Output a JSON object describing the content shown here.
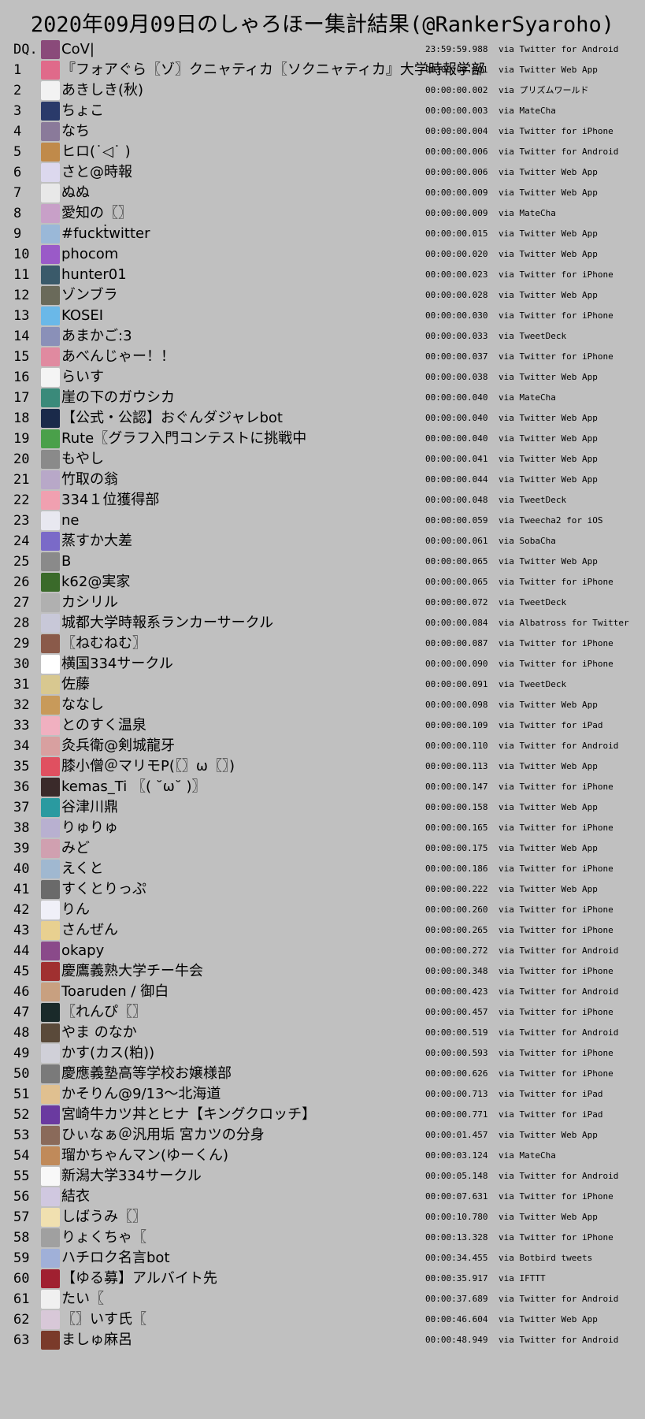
{
  "title": "2020年09月09日のしゃろほー集計結果(@RankerSyaroho)",
  "rows": [
    {
      "rank": "DQ.",
      "name": "CoV|",
      "time": "23:59:59.988",
      "via": "via Twitter for Android",
      "color": "#8a4a7a"
    },
    {
      "rank": "1",
      "name": "『フォアぐら〖ゾ〗クニャティカ〖ソクニャティカ』大学時報学部",
      "time": "00:00:00.001",
      "via": "via Twitter Web App",
      "color": "#e06a8a"
    },
    {
      "rank": "2",
      "name": "あきしき(秋)",
      "time": "00:00:00.002",
      "via": "via プリズムワールド",
      "color": "#f2f2f2"
    },
    {
      "rank": "3",
      "name": "ちょこ",
      "time": "00:00:00.003",
      "via": "via MateCha",
      "color": "#2a3a6a"
    },
    {
      "rank": "4",
      "name": "なち",
      "time": "00:00:00.004",
      "via": "via Twitter for iPhone",
      "color": "#8a7a9a"
    },
    {
      "rank": "5",
      "name": "ヒロ(˙◁˙ )",
      "time": "00:00:00.006",
      "via": "via Twitter for Android",
      "color": "#c08a4a"
    },
    {
      "rank": "6",
      "name": "さと@時報",
      "time": "00:00:00.006",
      "via": "via Twitter Web App",
      "color": "#dcd8ee"
    },
    {
      "rank": "7",
      "name": "ぬぬ",
      "time": "00:00:00.009",
      "via": "via Twitter Web App",
      "color": "#e8e8e8"
    },
    {
      "rank": "8",
      "name": "愛知の〖〗",
      "time": "00:00:00.009",
      "via": "via MateCha",
      "color": "#c8a0c8"
    },
    {
      "rank": "9",
      "name": "#fuckṫwitter",
      "time": "00:00:00.015",
      "via": "via Twitter Web App",
      "color": "#9ab8d8"
    },
    {
      "rank": "10",
      "name": "phocom",
      "time": "00:00:00.020",
      "via": "via Twitter Web App",
      "color": "#9a5ac8"
    },
    {
      "rank": "11",
      "name": "hunter01",
      "time": "00:00:00.023",
      "via": "via Twitter for iPhone",
      "color": "#3a5a6a"
    },
    {
      "rank": "12",
      "name": "ゾンブラ",
      "time": "00:00:00.028",
      "via": "via Twitter Web App",
      "color": "#6a6a5a"
    },
    {
      "rank": "13",
      "name": "KOSEI",
      "time": "00:00:00.030",
      "via": "via Twitter for iPhone",
      "color": "#6ab8e8"
    },
    {
      "rank": "14",
      "name": "あまかご:3",
      "time": "00:00:00.033",
      "via": "via TweetDeck",
      "color": "#8a90b8"
    },
    {
      "rank": "15",
      "name": "あべんじゃー！！",
      "time": "00:00:00.037",
      "via": "via Twitter for iPhone",
      "color": "#e08aa0"
    },
    {
      "rank": "16",
      "name": "らいす",
      "time": "00:00:00.038",
      "via": "via Twitter Web App",
      "color": "#f4f4f4"
    },
    {
      "rank": "17",
      "name": "崖の下のガウシカ",
      "time": "00:00:00.040",
      "via": "via MateCha",
      "color": "#3a8a7a"
    },
    {
      "rank": "18",
      "name": "【公式・公認】おぐんダジャレbot",
      "time": "00:00:00.040",
      "via": "via Twitter Web App",
      "color": "#1a2a4a"
    },
    {
      "rank": "19",
      "name": "Rute〖グラフ入門コンテストに挑戦中",
      "time": "00:00:00.040",
      "via": "via Twitter Web App",
      "color": "#4aa04a"
    },
    {
      "rank": "20",
      "name": "もやし",
      "time": "00:00:00.041",
      "via": "via Twitter Web App",
      "color": "#8a8a8a"
    },
    {
      "rank": "21",
      "name": "竹取の翁",
      "time": "00:00:00.044",
      "via": "via Twitter Web App",
      "color": "#b8a8c8"
    },
    {
      "rank": "22",
      "name": "334１位獲得部",
      "time": "00:00:00.048",
      "via": "via TweetDeck",
      "color": "#f0a0b0"
    },
    {
      "rank": "23",
      "name": "ne",
      "time": "00:00:00.059",
      "via": "via Tweecha2 for iOS",
      "color": "#e8e8f0"
    },
    {
      "rank": "24",
      "name": "蒸すか大差",
      "time": "00:00:00.061",
      "via": "via SobaCha",
      "color": "#7a6ac8"
    },
    {
      "rank": "25",
      "name": "B",
      "time": "00:00:00.065",
      "via": "via Twitter Web App",
      "color": "#8a8a8a"
    },
    {
      "rank": "26",
      "name": "k62@実家",
      "time": "00:00:00.065",
      "via": "via Twitter for iPhone",
      "color": "#3a6a2a"
    },
    {
      "rank": "27",
      "name": "カシリル",
      "time": "00:00:00.072",
      "via": "via TweetDeck",
      "color": "#b0b0b0"
    },
    {
      "rank": "28",
      "name": "城都大学時報系ランカーサークル",
      "time": "00:00:00.084",
      "via": "via Albatross for Twitter",
      "color": "#c8c8d8"
    },
    {
      "rank": "29",
      "name": "〖ねむねむ〗",
      "time": "00:00:00.087",
      "via": "via Twitter for iPhone",
      "color": "#8a5a4a"
    },
    {
      "rank": "30",
      "name": "横国334サークル",
      "time": "00:00:00.090",
      "via": "via Twitter for iPhone",
      "color": "#ffffff"
    },
    {
      "rank": "31",
      "name": "佐藤",
      "time": "00:00:00.091",
      "via": "via TweetDeck",
      "color": "#d8c890"
    },
    {
      "rank": "32",
      "name": "ななし",
      "time": "00:00:00.098",
      "via": "via Twitter Web App",
      "color": "#c89a5a"
    },
    {
      "rank": "33",
      "name": "とのすく温泉",
      "time": "00:00:00.109",
      "via": "via Twitter for iPad",
      "color": "#f0b0c0"
    },
    {
      "rank": "34",
      "name": "灸兵衛@剣城龍牙",
      "time": "00:00:00.110",
      "via": "via Twitter for Android",
      "color": "#d8a0a0"
    },
    {
      "rank": "35",
      "name": "膝小僧＠マリモP(〖〗ω〖〗)",
      "time": "00:00:00.113",
      "via": "via Twitter Web App",
      "color": "#e05060"
    },
    {
      "rank": "36",
      "name": "kemas_Ti 〖( ˘ω˘ )〗",
      "time": "00:00:00.147",
      "via": "via Twitter for iPhone",
      "color": "#3a2a2a"
    },
    {
      "rank": "37",
      "name": "谷津川鼎",
      "time": "00:00:00.158",
      "via": "via Twitter Web App",
      "color": "#2a9aa0"
    },
    {
      "rank": "38",
      "name": "りゅりゅ",
      "time": "00:00:00.165",
      "via": "via Twitter for iPhone",
      "color": "#b8b0d0"
    },
    {
      "rank": "39",
      "name": "みど",
      "time": "00:00:00.175",
      "via": "via Twitter Web App",
      "color": "#d0a0b0"
    },
    {
      "rank": "40",
      "name": "えくと",
      "time": "00:00:00.186",
      "via": "via Twitter for iPhone",
      "color": "#a0b8d0"
    },
    {
      "rank": "41",
      "name": "すくとりっぷ",
      "time": "00:00:00.222",
      "via": "via Twitter Web App",
      "color": "#6a6a6a"
    },
    {
      "rank": "42",
      "name": "りん",
      "time": "00:00:00.260",
      "via": "via Twitter for iPhone",
      "color": "#f0f0f8"
    },
    {
      "rank": "43",
      "name": "さんぜん",
      "time": "00:00:00.265",
      "via": "via Twitter for iPhone",
      "color": "#e8d090"
    },
    {
      "rank": "44",
      "name": "okapy",
      "time": "00:00:00.272",
      "via": "via Twitter for Android",
      "color": "#8a4a8a"
    },
    {
      "rank": "45",
      "name": "慶鷹義熟大学チー牛会",
      "time": "00:00:00.348",
      "via": "via Twitter for iPhone",
      "color": "#a03030"
    },
    {
      "rank": "46",
      "name": "Toaruden / 御白",
      "time": "00:00:00.423",
      "via": "via Twitter for Android",
      "color": "#c8a080"
    },
    {
      "rank": "47",
      "name": "〖れんぴ〖〗",
      "time": "00:00:00.457",
      "via": "via Twitter for iPhone",
      "color": "#1a2a2a"
    },
    {
      "rank": "48",
      "name": "やま のなか",
      "time": "00:00:00.519",
      "via": "via Twitter for Android",
      "color": "#5a4a3a"
    },
    {
      "rank": "49",
      "name": "かす(カス(粕))",
      "time": "00:00:00.593",
      "via": "via Twitter for iPhone",
      "color": "#d0d0d8"
    },
    {
      "rank": "50",
      "name": "慶應義塾高等学校お嬢様部",
      "time": "00:00:00.626",
      "via": "via Twitter for iPhone",
      "color": "#7a7a7a"
    },
    {
      "rank": "51",
      "name": "かそりん@9/13〜北海道",
      "time": "00:00:00.713",
      "via": "via Twitter for iPad",
      "color": "#e0c090"
    },
    {
      "rank": "52",
      "name": "宮崎牛カツ丼とヒナ【キングクロッチ】",
      "time": "00:00:00.771",
      "via": "via Twitter for iPad",
      "color": "#6a3aa0"
    },
    {
      "rank": "53",
      "name": "ひぃなぁ＠汎用垢 宮カツの分身",
      "time": "00:00:01.457",
      "via": "via Twitter Web App",
      "color": "#8a6a5a"
    },
    {
      "rank": "54",
      "name": "瑠かちゃんマン(ゆーくん)",
      "time": "00:00:03.124",
      "via": "via MateCha",
      "color": "#c08a5a"
    },
    {
      "rank": "55",
      "name": "新潟大学334サークル",
      "time": "00:00:05.148",
      "via": "via Twitter for Android",
      "color": "#f8f8f8"
    },
    {
      "rank": "56",
      "name": "結衣",
      "time": "00:00:07.631",
      "via": "via Twitter for iPhone",
      "color": "#d0c8e0"
    },
    {
      "rank": "57",
      "name": "しばうみ〖〗",
      "time": "00:00:10.780",
      "via": "via Twitter Web App",
      "color": "#f0e0b0"
    },
    {
      "rank": "58",
      "name": "りょくちゃ〖",
      "time": "00:00:13.328",
      "via": "via Twitter for iPhone",
      "color": "#a0a0a0"
    },
    {
      "rank": "59",
      "name": "ハチロク名言bot",
      "time": "00:00:34.455",
      "via": "via Botbird tweets",
      "color": "#a0b0d8"
    },
    {
      "rank": "60",
      "name": "【ゆる募】アルバイト先",
      "time": "00:00:35.917",
      "via": "via IFTTT",
      "color": "#a02030"
    },
    {
      "rank": "61",
      "name": "たい〖",
      "time": "00:00:37.689",
      "via": "via Twitter for Android",
      "color": "#f0f0f0"
    },
    {
      "rank": "62",
      "name": "〖〗いす氏〖",
      "time": "00:00:46.604",
      "via": "via Twitter Web App",
      "color": "#d8c8d8"
    },
    {
      "rank": "63",
      "name": "ましゅ麻呂",
      "time": "00:00:48.949",
      "via": "via Twitter for Android",
      "color": "#7a3a2a"
    }
  ]
}
